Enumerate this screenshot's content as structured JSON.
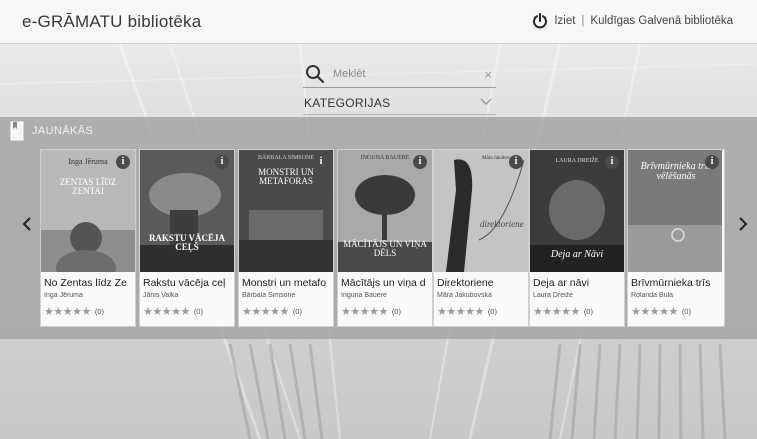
{
  "header": {
    "brand": "e-GRĀMATU bibliotēka",
    "logout_label": "Iziet",
    "separator": "|",
    "library_name": "Kuldīgas Galvenā bibliotēka"
  },
  "search": {
    "placeholder": "Meklēt",
    "clear_glyph": "×"
  },
  "categories": {
    "label": "KATEGORIJAS"
  },
  "section": {
    "title": "JAUNĀKĀS"
  },
  "books": [
    {
      "title": "No Zentas līdz Ze",
      "author": "Inga Jēruma",
      "stars": "★★★★★",
      "count": "(0)",
      "cover_author": "Inga Jēruma",
      "cover_title": "ZENTAS LĪDZ ZENTAI"
    },
    {
      "title": "Rakstu vācēja ceļ",
      "author": "Jānis Valka",
      "stars": "★★★★★",
      "count": "(0)",
      "cover_author": "",
      "cover_title": "RAKSTU VĀCĒJA CEĻŠ"
    },
    {
      "title": "Monstri un metafo",
      "author": "Bārbala Simsone",
      "stars": "★★★★★",
      "count": "(0)",
      "cover_author": "BĀRBALA SIMSONE",
      "cover_title": "MONSTRI UN METAFORAS"
    },
    {
      "title": "Mācītājs un viņa d",
      "author": "Inguna Bauere",
      "stars": "★★★★★",
      "count": "(0)",
      "cover_author": "INGUNA BAUERE",
      "cover_title": "MĀCĪTĀJS UN VIŅA DĒLS"
    },
    {
      "title": "Direktoriene",
      "author": "Māra Jakubovska",
      "stars": "★★★★★",
      "count": "(0)",
      "cover_author": "Māra Jakubovska",
      "cover_title": "direktoriene"
    },
    {
      "title": "Deja ar nāvi",
      "author": "Laura Dreiže",
      "stars": "★★★★★",
      "count": "(0)",
      "cover_author": "LAURA DREIŽE",
      "cover_title": "Deja ar Nāvi"
    },
    {
      "title": "Brīvmūrnieka trīs",
      "author": "Rolanda Bula",
      "stars": "★★★★★",
      "count": "(0)",
      "cover_author": "",
      "cover_title": "Brīvmūrnieka trīs vēlēšanās"
    }
  ],
  "icons": {
    "power": "power-icon",
    "search": "search-icon",
    "clear": "close-icon",
    "dropdown": "chevron-down-icon",
    "section": "bookmark-icon",
    "prev": "chevron-left-icon",
    "next": "chevron-right-icon",
    "info": "info-icon"
  },
  "info_glyph": "i"
}
